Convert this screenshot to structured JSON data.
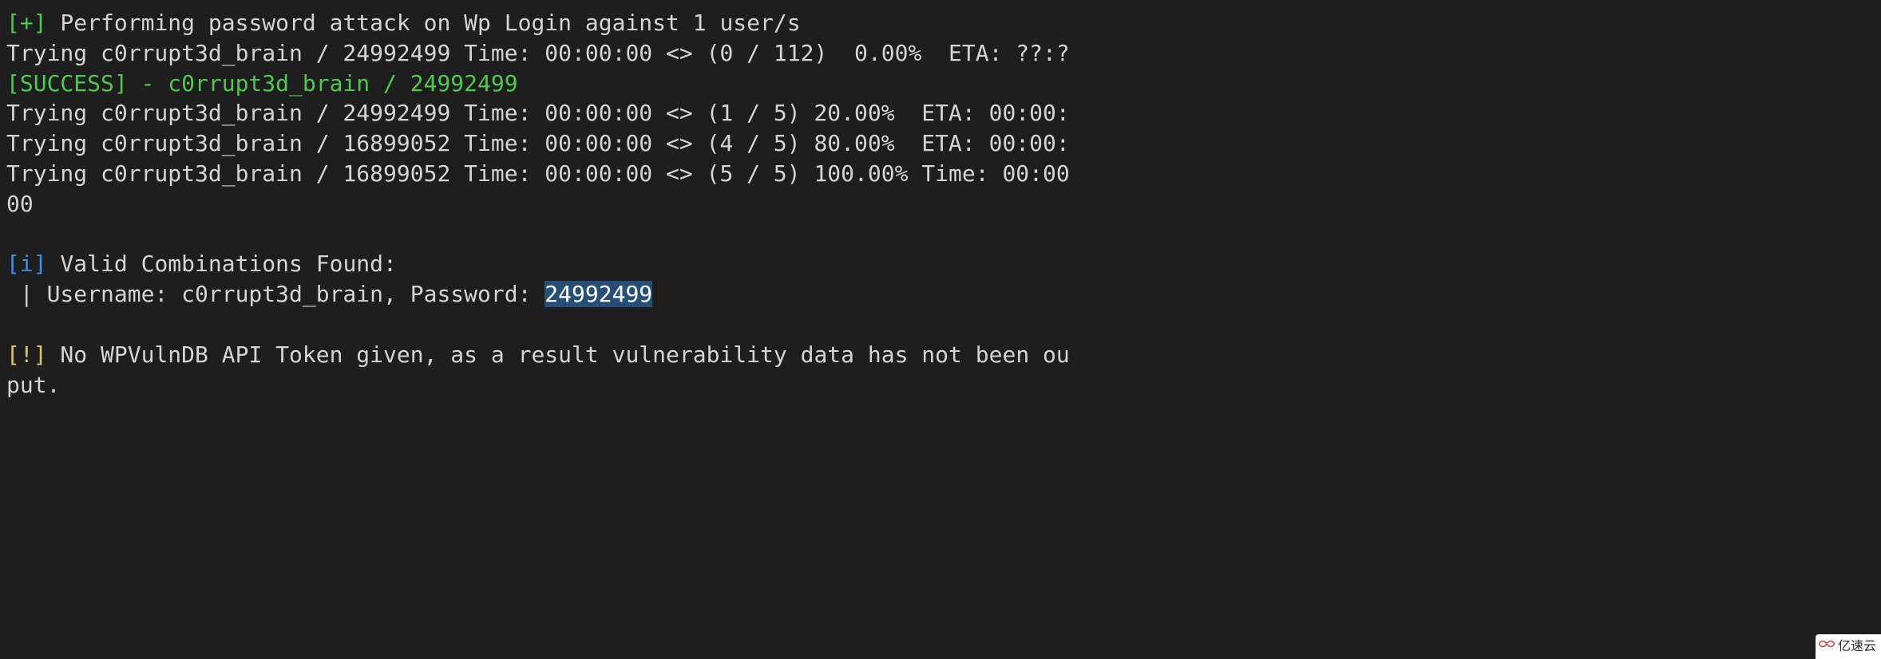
{
  "colors": {
    "green": "#4ec94e",
    "blue": "#3b8eea",
    "yellow": "#d7c95c",
    "selection_bg": "#264f78"
  },
  "lines": {
    "l1_prefix": "[+]",
    "l1_text": " Performing password attack on Wp Login against 1 user/s",
    "l2": "Trying c0rrupt3d_brain / 24992499 Time: 00:00:00 <> (0 / 112)  0.00%  ETA: ??:?",
    "l3": "[SUCCESS] - c0rrupt3d_brain / 24992499",
    "l4": "Trying c0rrupt3d_brain / 24992499 Time: 00:00:00 <> (1 / 5) 20.00%  ETA: 00:00:",
    "l5": "Trying c0rrupt3d_brain / 16899052 Time: 00:00:00 <> (4 / 5) 80.00%  ETA: 00:00:",
    "l6": "Trying c0rrupt3d_brain / 16899052 Time: 00:00:00 <> (5 / 5) 100.00% Time: 00:00",
    "l7": "00",
    "l8": "",
    "l9_prefix": "[i]",
    "l9_text": " Valid Combinations Found:",
    "l10_pre": " | Username: c0rrupt3d_brain, Password: ",
    "l10_sel": "24992499",
    "l11": "",
    "l12_prefix": "[!]",
    "l12_text": " No WPVulnDB API Token given, as a result vulnerability data has not been ou",
    "l13": "put."
  },
  "watermark": {
    "text": "亿速云"
  }
}
